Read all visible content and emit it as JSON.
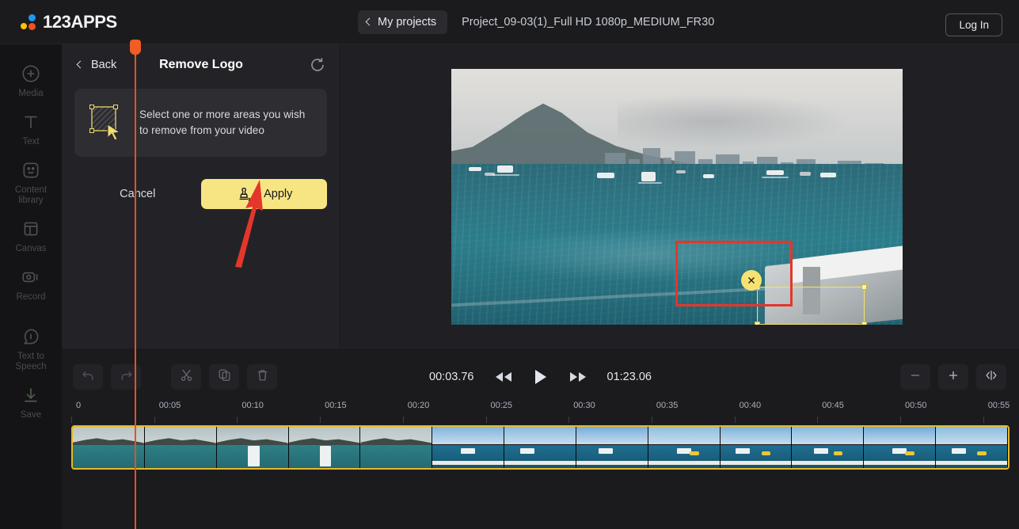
{
  "topbar": {
    "logo_text": "123APPS",
    "logo_colors": {
      "blue": "#2196f3",
      "yellow": "#ffc107",
      "orange": "#f4511e"
    },
    "my_projects_label": "My projects",
    "project_title": "Project_09-03(1)_Full HD 1080p_MEDIUM_FR30",
    "login_label": "Log In"
  },
  "sidebar": {
    "items": [
      {
        "label": "Media",
        "icon": "plus-circle-icon"
      },
      {
        "label": "Text",
        "icon": "text-t-icon"
      },
      {
        "label": "Content library",
        "icon": "sticker-smiley-icon"
      },
      {
        "label": "Canvas",
        "icon": "canvas-frame-icon"
      },
      {
        "label": "Record",
        "icon": "video-camera-icon"
      },
      {
        "label": "Text to Speech",
        "icon": "speech-bubble-icon"
      },
      {
        "label": "Save",
        "icon": "download-icon"
      }
    ]
  },
  "panel": {
    "back_label": "Back",
    "title": "Remove Logo",
    "reset_icon": "reset-arrow-icon",
    "info_icon": "hatched-selection-icon",
    "info_text": "Select one or more areas you wish to remove from your video",
    "cancel_label": "Cancel",
    "apply_label": "Apply",
    "apply_icon": "stamp-remove-icon",
    "apply_color": "#f7e583"
  },
  "stage": {
    "selection": {
      "delete_icon": "close-x-icon",
      "handles": 4,
      "outline_color": "#f5e26a"
    },
    "annotation": {
      "rect_color": "#e4362a",
      "arrow_color": "#e4362a"
    }
  },
  "timeline": {
    "tools": [
      {
        "name": "undo-button",
        "icon": "undo-arrow-icon"
      },
      {
        "name": "redo-button",
        "icon": "redo-arrow-icon"
      },
      {
        "name": "split-button",
        "icon": "scissors-icon"
      },
      {
        "name": "duplicate-button",
        "icon": "copy-icon"
      },
      {
        "name": "delete-button",
        "icon": "trash-icon"
      }
    ],
    "current_time": "00:03.76",
    "total_time": "01:23.06",
    "transport": [
      {
        "name": "rewind-button",
        "icon": "rewind-icon"
      },
      {
        "name": "play-button",
        "icon": "play-icon"
      },
      {
        "name": "fast-forward-button",
        "icon": "fast-forward-icon"
      }
    ],
    "zoom_controls": [
      {
        "name": "zoom-out-button",
        "icon": "minus-icon"
      },
      {
        "name": "zoom-in-button",
        "icon": "plus-icon"
      },
      {
        "name": "fit-to-screen-button",
        "icon": "fit-width-icon"
      }
    ],
    "ruler_ticks": [
      "0",
      "00:05",
      "00:10",
      "00:15",
      "00:20",
      "00:25",
      "00:30",
      "00:35",
      "00:40",
      "00:45",
      "00:50",
      "00:55"
    ],
    "clip_border_color": "#e8b923",
    "playhead_color": "#e2522a",
    "thumbnail_count": 13
  }
}
